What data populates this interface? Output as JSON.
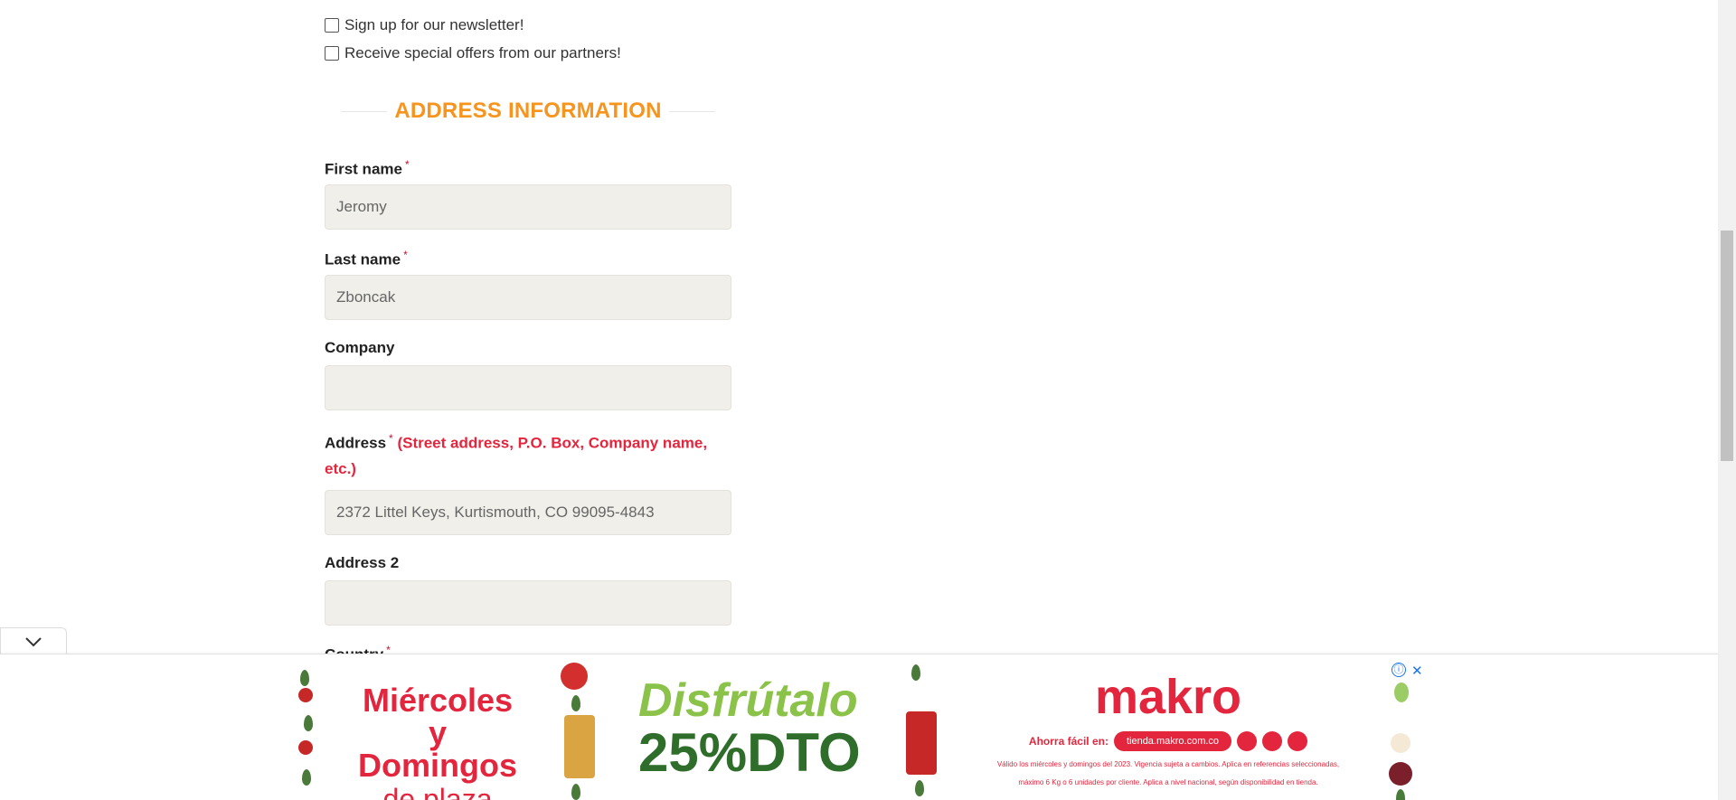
{
  "checkboxes": {
    "newsletter": "Sign up for our newsletter!",
    "partners": "Receive special offers from our partners!"
  },
  "section": {
    "title": "ADDRESS INFORMATION"
  },
  "fields": {
    "first_name": {
      "label": "First name",
      "required": "*",
      "value": "Jeromy"
    },
    "last_name": {
      "label": "Last name",
      "required": "*",
      "value": "Zboncak"
    },
    "company": {
      "label": "Company",
      "value": ""
    },
    "address": {
      "label": "Address",
      "required": "*",
      "hint_line1": "(Street address, P.O. Box, Company name,",
      "hint_line2": "etc.)",
      "value": "2372 Littel Keys, Kurtismouth, CO 99095-4843"
    },
    "address2": {
      "label": "Address 2",
      "value": ""
    },
    "country": {
      "label": "Country",
      "required": "*"
    }
  },
  "ad": {
    "collapse_icon": "chevron-down-icon",
    "info_symbol": "ⓘ",
    "close_symbol": "✕",
    "left_line1": "Miércoles y",
    "left_line2": "Domingos",
    "left_line3": "de plaza",
    "mid_line1": "Disfrútalo",
    "mid_line2": "25%DTO",
    "brand": "makro",
    "easy_label": "Ahorra fácil en:",
    "url": "tienda.makro.com.co",
    "fine_print_1": "Válido los miércoles y domingos del 2023. Vigencia sujeta a cambios. Aplica en referencias seleccionadas,",
    "fine_print_2": "máximo 6 Kg o 6 unidades por cliente. Aplica a nivel nacional, según disponibilidad en tienda.",
    "colors": {
      "red": "#e3263d",
      "green_light": "#8bc34a",
      "green_dark": "#2f6e2a"
    }
  },
  "colors": {
    "accent": "#f7941d",
    "input_bg": "#f0efe9",
    "hint_red": "#e3263d"
  }
}
